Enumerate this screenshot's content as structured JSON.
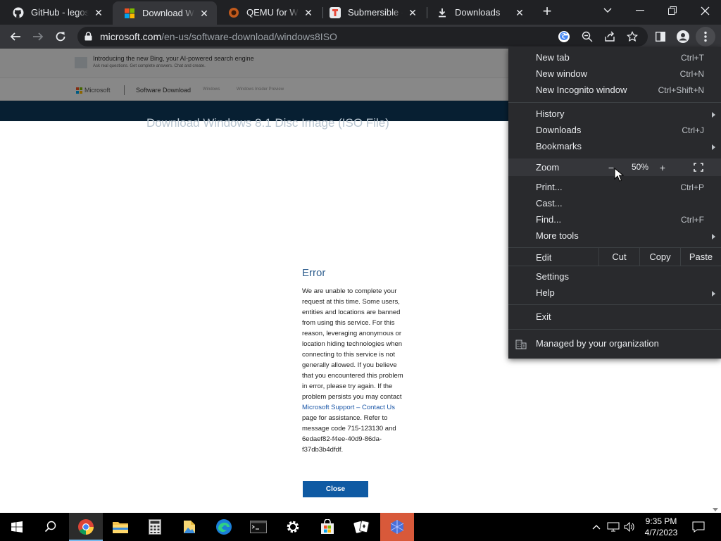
{
  "tabs": [
    {
      "label": "GitHub - legoskip",
      "icon": "github-icon"
    },
    {
      "label": "Download Windows",
      "icon": "microsoft-icon",
      "active": true
    },
    {
      "label": "QEMU for Windows",
      "icon": "qemu-icon"
    },
    {
      "label": "Submersible - Tum",
      "icon": "tumblr-icon"
    },
    {
      "label": "Downloads",
      "icon": "download-icon"
    }
  ],
  "window_controls": [
    "tab-search",
    "minimize",
    "restore",
    "close"
  ],
  "toolbar": {
    "url_host": "microsoft.com",
    "url_path": "/en-us/software-download/windows8ISO"
  },
  "page": {
    "banner_text": "Introducing the new Bing, your AI-powered search engine",
    "banner_sub": "Ask real questions. Get complete answers. Chat and create.",
    "ms_brand": "Microsoft",
    "ms_section": "Software Download",
    "ms_nav_1": "Windows",
    "ms_nav_2": "Windows Insider Preview",
    "band_title": "Download Windows 8.1 Disc Image (ISO File)",
    "error_title": "Error",
    "error_body_1": "We are unable to complete your request at this time. Some users, entities and locations are banned from using this service. For this reason, leveraging anonymous or location hiding technologies when connecting to this service is not generally allowed. If you believe that you encountered this problem in error, please try again. If the problem persists you may contact ",
    "error_link": "Microsoft Support – Contact Us",
    "error_body_2": " page for assistance. Refer to message code 715-123130 and 6edaef82-f4ee-40d9-86da-f37db3b4dfdf.",
    "close_label": "Close"
  },
  "menu": {
    "new_tab": "New tab",
    "new_tab_sc": "Ctrl+T",
    "new_window": "New window",
    "new_window_sc": "Ctrl+N",
    "incognito": "New Incognito window",
    "incognito_sc": "Ctrl+Shift+N",
    "history": "History",
    "downloads": "Downloads",
    "downloads_sc": "Ctrl+J",
    "bookmarks": "Bookmarks",
    "zoom": "Zoom",
    "zoom_minus": "−",
    "zoom_value": "50%",
    "zoom_plus": "+",
    "print": "Print...",
    "print_sc": "Ctrl+P",
    "cast": "Cast...",
    "find": "Find...",
    "find_sc": "Ctrl+F",
    "more_tools": "More tools",
    "edit": "Edit",
    "cut": "Cut",
    "copy": "Copy",
    "paste": "Paste",
    "settings": "Settings",
    "help": "Help",
    "exit": "Exit",
    "managed": "Managed by your organization"
  },
  "taskbar": {
    "time": "9:35 PM",
    "date": "4/7/2023",
    "apps": [
      "start",
      "search",
      "chrome",
      "file-explorer",
      "calculator",
      "folder",
      "edge",
      "terminal",
      "settings",
      "store",
      "solitaire",
      "app"
    ]
  }
}
